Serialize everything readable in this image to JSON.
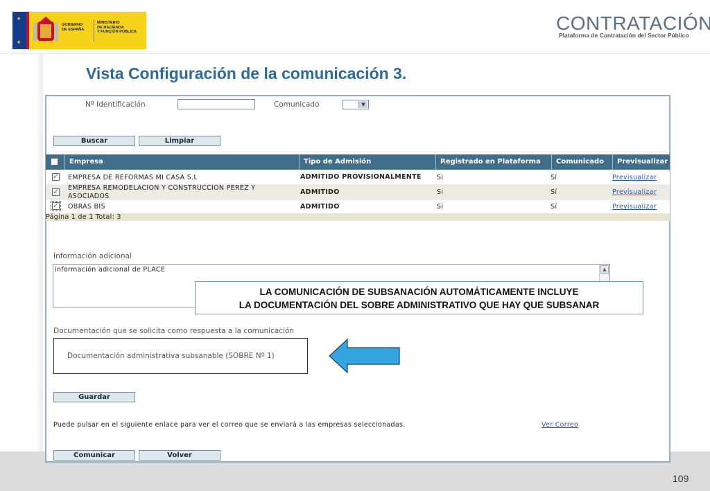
{
  "header": {
    "gov_logo_text": "GOBIERNO\nDE ESPAÑA",
    "ministry_text": "MINISTERIO\nDE HACIENDA\nY FUNCIÓN PÚBLICA",
    "brand_name": "CONTRATACIÓN",
    "brand_subtitle": "Plataforma de Contratación del Sector Público"
  },
  "slide_title": "Vista Configuración de la comunicación 3.",
  "form": {
    "id_label": "Nº Identificación",
    "id_value": "",
    "comunicado_label": "Comunicado",
    "comunicado_value": "",
    "search_label": "Buscar",
    "clear_label": "Limpiar"
  },
  "table": {
    "columns": [
      "Empresa",
      "Tipo de Admisión",
      "Registrado en Plataforma",
      "Comunicado",
      "Previsualizar"
    ],
    "rows": [
      {
        "empresa": "EMPRESA DE REFORMAS MI CASA S.L",
        "tipo": "ADMITIDO PROVISIONALMENTE",
        "registrado": "Si",
        "comunicado": "Sí",
        "link": "Previsualizar",
        "checked": true
      },
      {
        "empresa": "EMPRESA REMODELACION Y CONSTRUCCION PEREZ Y ASOCIADOS",
        "tipo": "ADMITIDO",
        "registrado": "Si",
        "comunicado": "Sí",
        "link": "Previsualizar",
        "checked": true
      },
      {
        "empresa": "OBRAS BIS",
        "tipo": "ADMITIDO",
        "registrado": "Si",
        "comunicado": "Sí",
        "link": "Previsualizar",
        "checked": true
      }
    ],
    "pager": "Página 1 de 1 Total: 3"
  },
  "info": {
    "label": "Información adicional",
    "value": "información adicional de PLACE"
  },
  "callout": {
    "line1": "LA COMUNICACIÓN DE SUBSANACIÓN AUTOMÁTICAMENTE INCLUYE",
    "line2": "LA DOCUMENTACIÓN DEL SOBRE ADMINISTRATIVO QUE HAY QUE SUBSANAR"
  },
  "docs": {
    "label": "Documentación que se solicita como respuesta a la comunicación",
    "item": "Documentación administrativa subsanable (SOBRE Nº 1)"
  },
  "save_label": "Guardar",
  "email": {
    "text": "Puede pulsar en el siguiente enlace para ver el correo que se enviará a las empresas seleccionadas.",
    "link": "Ver Correo"
  },
  "bottom_buttons": {
    "send": "Comunicar",
    "back": "Volver"
  },
  "page_number": "109",
  "colors": {
    "title": "#2b6a9e",
    "table_header": "#3f6d8a",
    "arrow": "#33a6e0",
    "button_bg": "#dce9ec"
  }
}
